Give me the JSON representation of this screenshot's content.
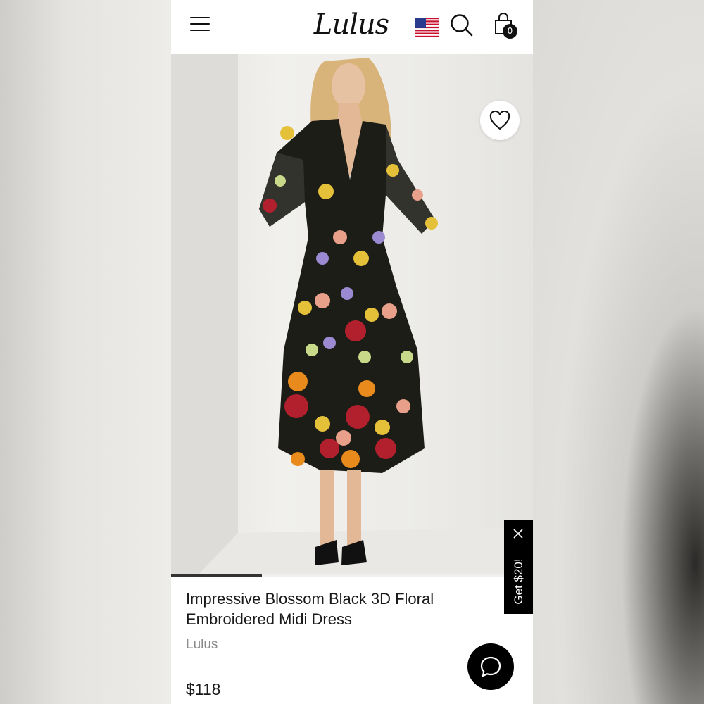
{
  "header": {
    "logo_text": "Lulus",
    "cart_count": "0",
    "icons": [
      "menu-icon",
      "us-flag-icon",
      "search-icon",
      "shopping-bag-icon"
    ]
  },
  "hero": {
    "gallery_progress": 0.25,
    "favorite_icon": "heart-icon"
  },
  "product": {
    "title": "Impressive Blossom Black 3D Floral Embroidered Midi Dress",
    "brand": "Lulus",
    "price": "$118"
  },
  "promo": {
    "label": "Get $20!",
    "close_icon": "close-icon"
  },
  "chat": {
    "icon": "chat-bubble-icon"
  },
  "colors": {
    "background": "#ffffff",
    "text": "#1a1a1a",
    "muted": "#8a8a8a",
    "promo_bg": "#000000"
  }
}
